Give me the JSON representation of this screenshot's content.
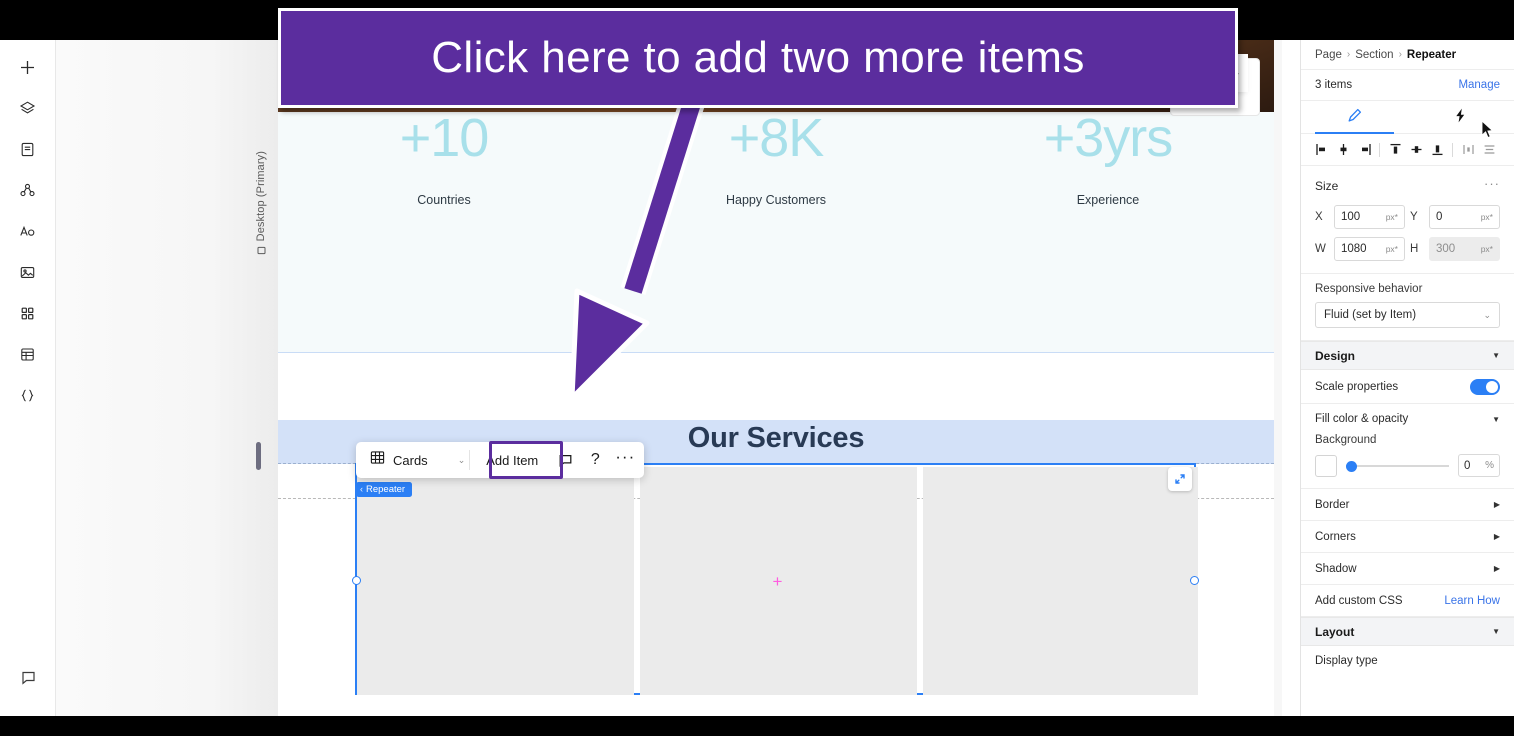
{
  "annotation": {
    "callout_text": "Click here to add two more items",
    "callout_color": "#5b2d9e",
    "arrow_color": "#5b2d9e"
  },
  "left_rail": {
    "items": [
      {
        "icon": "plus-icon",
        "name": "add-element"
      },
      {
        "icon": "layers-icon",
        "name": "layers"
      },
      {
        "icon": "page-icon",
        "name": "pages"
      },
      {
        "icon": "connect-icon",
        "name": "connect-data"
      },
      {
        "icon": "text-icon",
        "name": "text"
      },
      {
        "icon": "image-icon",
        "name": "media"
      },
      {
        "icon": "apps-icon",
        "name": "apps"
      },
      {
        "icon": "table-icon",
        "name": "cms"
      },
      {
        "icon": "code-icon",
        "name": "dev-mode"
      }
    ],
    "bottom_icon": "chat-icon"
  },
  "canvas": {
    "device_label": "Desktop (Primary)",
    "device_icon": "monitor-icon",
    "stats": [
      {
        "value": "+10",
        "label": "Countries"
      },
      {
        "value": "+8K",
        "label": "Happy Customers"
      },
      {
        "value": "+3yrs",
        "label": "Experience"
      }
    ],
    "stat_color": "#a8e0ea",
    "section_title": "Our Services",
    "repeater_chip": "Repeater",
    "repeater_chip_chevron": "‹",
    "cards": [
      "card-1",
      "card-2",
      "card-3"
    ],
    "add_placeholder_icon": "plus-mark",
    "expand_icon": "expand-icon"
  },
  "toolbar": {
    "layout_icon": "grid-icon",
    "layout_label": "Cards",
    "layout_chevron": "⌄",
    "add_item_label": "Add Item",
    "comment_icon": "comment-icon",
    "help_label": "?",
    "more_label": "···",
    "highlight_color": "#5b2d9e"
  },
  "panel_collapse": {
    "chevron": "›"
  },
  "inspector": {
    "breadcrumb": {
      "items": [
        "Page",
        "Section",
        "Repeater"
      ],
      "separator": "›"
    },
    "items_count": "3 items",
    "manage_label": "Manage",
    "tabs": [
      {
        "name": "design-tab",
        "icon": "brush-icon",
        "active": true
      },
      {
        "name": "interactions-tab",
        "icon": "lightning-icon",
        "active": false
      }
    ],
    "align_buttons": [
      "align-left-icon",
      "align-center-h-icon",
      "align-right-icon",
      "align-top-icon",
      "align-middle-icon",
      "align-bottom-icon",
      "distribute-h-icon",
      "distribute-v-icon"
    ],
    "size": {
      "title": "Size",
      "more_icon": "···",
      "fields": [
        {
          "label": "X",
          "value": "100",
          "unit": "px*",
          "disabled": false
        },
        {
          "label": "Y",
          "value": "0",
          "unit": "px*",
          "disabled": false
        },
        {
          "label": "W",
          "value": "1080",
          "unit": "px*",
          "disabled": false
        },
        {
          "label": "H",
          "value": "300",
          "unit": "px*",
          "disabled": true
        }
      ]
    },
    "responsive": {
      "label": "Responsive behavior",
      "value": "Fluid (set by Item)",
      "chevron": "⌄"
    },
    "design": {
      "title": "Design",
      "caret": "▼",
      "scale_properties_label": "Scale properties",
      "scale_properties_on": true,
      "fill_title": "Fill color & opacity",
      "fill_caret": "▼",
      "background_label": "Background",
      "background_swatch": "#ffffff",
      "opacity_value": "0",
      "opacity_unit": "%",
      "rows": [
        {
          "label": "Border",
          "caret": "▶"
        },
        {
          "label": "Corners",
          "caret": "▶"
        },
        {
          "label": "Shadow",
          "caret": "▶"
        }
      ],
      "custom_css_label": "Add custom CSS",
      "learn_how_label": "Learn How"
    },
    "layout": {
      "title": "Layout",
      "caret": "▼",
      "display_type_label": "Display type"
    }
  }
}
